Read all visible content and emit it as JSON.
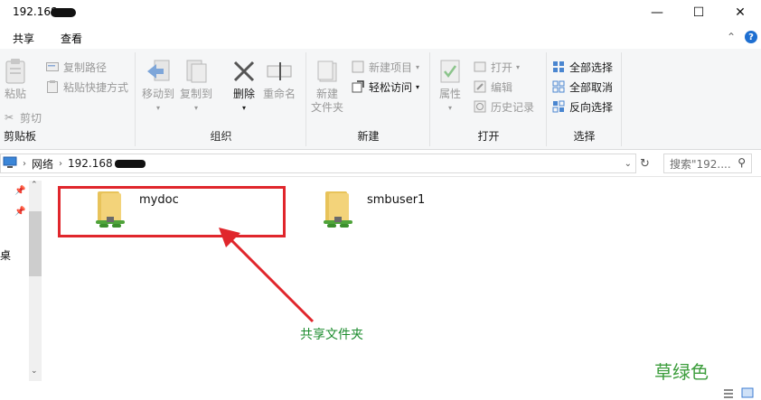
{
  "window": {
    "title": "192.168.",
    "minimize": "—",
    "maximize": "☐",
    "close": "✕"
  },
  "menu": {
    "share": "共享",
    "view": "查看",
    "collapse": "⌃",
    "help": "?"
  },
  "ribbon": {
    "clipboard": {
      "label": "剪贴板",
      "paste": "粘贴",
      "cut": "剪切",
      "copy_path": "复制路径",
      "paste_shortcut": "粘贴快捷方式"
    },
    "organize": {
      "label": "组织",
      "move_to": "移动到",
      "copy_to": "复制到",
      "delete": "删除",
      "rename": "重命名"
    },
    "new": {
      "label": "新建",
      "new_folder_line1": "新建",
      "new_folder_line2": "文件夹",
      "new_item": "新建项目",
      "easy_access": "轻松访问"
    },
    "open": {
      "label": "打开",
      "properties": "属性",
      "open": "打开",
      "edit": "编辑",
      "history": "历史记录"
    },
    "select": {
      "label": "选择",
      "select_all": "全部选择",
      "select_none": "全部取消",
      "invert": "反向选择"
    }
  },
  "address": {
    "network": "网络",
    "ip": "192.168",
    "search_placeholder": "搜索\"192...."
  },
  "nav": {
    "partial_label": "桌"
  },
  "items": [
    {
      "name": "mydoc"
    },
    {
      "name": "smbuser1"
    }
  ],
  "annotation": "共享文件夹",
  "watermark": "草绿色",
  "colors": {
    "highlight": "#e0262c",
    "annotation": "#1c8c2e",
    "accent": "#1e6fd1"
  }
}
